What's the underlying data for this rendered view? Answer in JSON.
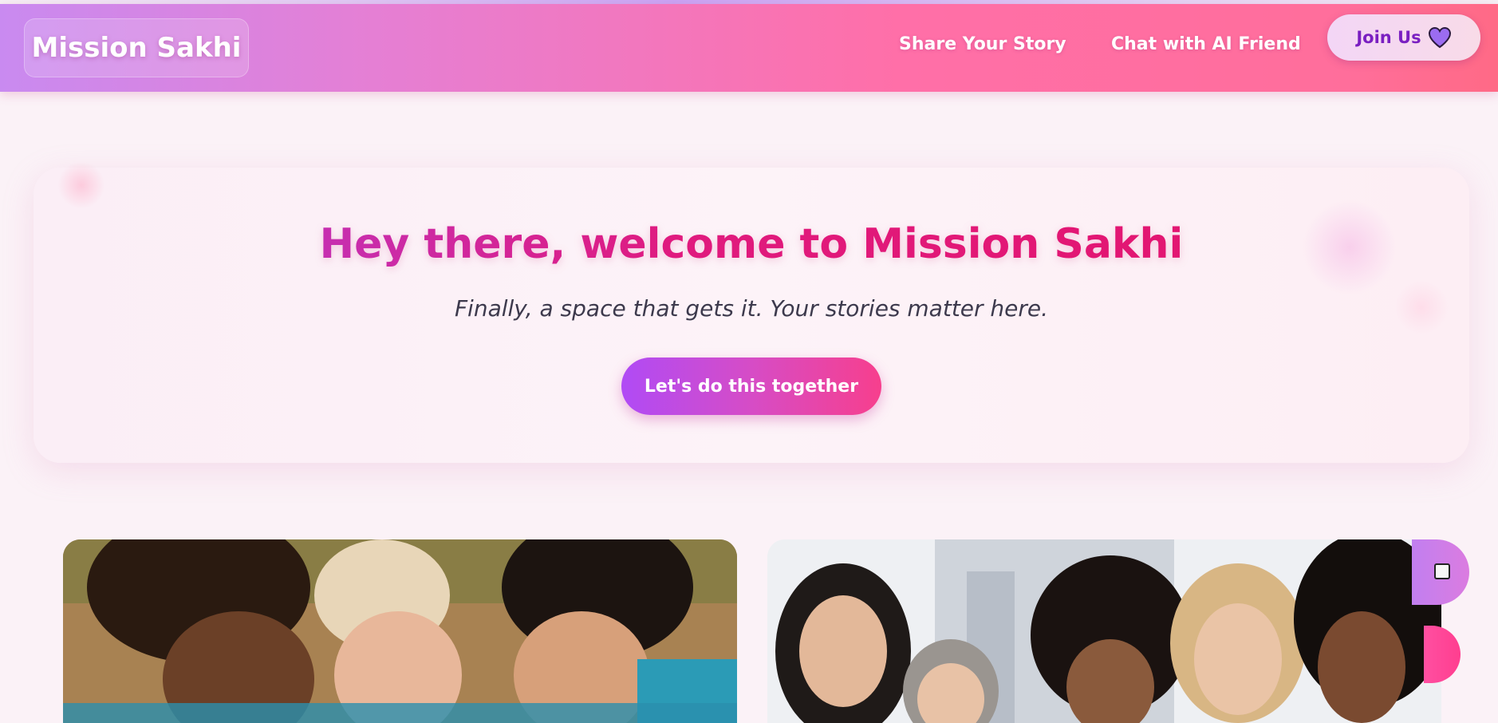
{
  "navbar": {
    "brand": "Mission Sakhi",
    "links": [
      {
        "label": "Share Your Story"
      },
      {
        "label": "Chat with AI Friend"
      }
    ],
    "join_button": {
      "label": "Join Us",
      "icon": "heart-icon"
    }
  },
  "hero": {
    "title": "Hey there, welcome to Mission Sakhi",
    "subtitle": "Finally, a space that gets it. Your stories matter here.",
    "cta_label": "Let's do this together"
  },
  "colors": {
    "accent_purple": "#b04bf5",
    "accent_pink": "#f73f8d",
    "title_pink": "#e01a7e",
    "join_text": "#7a1fc1"
  },
  "gallery": {
    "images": [
      {
        "description_icon": "group-of-smiling-women-photo"
      },
      {
        "description_icon": "diverse-women-smiling-photo"
      }
    ]
  },
  "floating_buttons": [
    {
      "icon": "chat-icon"
    },
    {
      "icon": "action-icon"
    }
  ]
}
